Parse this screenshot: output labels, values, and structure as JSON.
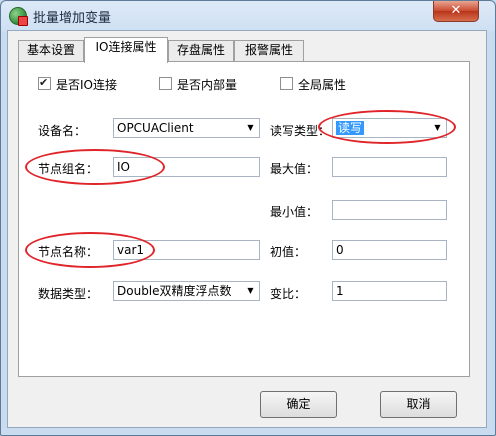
{
  "window": {
    "title": "批量增加变量",
    "close_glyph": "✕"
  },
  "tabs": [
    {
      "label": "基本设置"
    },
    {
      "label": "IO连接属性"
    },
    {
      "label": "存盘属性"
    },
    {
      "label": "报警属性"
    }
  ],
  "checkboxes": {
    "io_connect": {
      "label": "是否IO连接",
      "checked": true
    },
    "internal": {
      "label": "是否内部量",
      "checked": false
    },
    "global": {
      "label": "全局属性",
      "checked": false
    }
  },
  "fields": {
    "device_name": {
      "label": "设备名：",
      "value": "OPCUAClient"
    },
    "rw_type": {
      "label": "读写类型：",
      "value": "读写"
    },
    "node_group": {
      "label": "节点组名：",
      "value": "IO"
    },
    "max_value": {
      "label": "最大值：",
      "value": ""
    },
    "min_value": {
      "label": "最小值：",
      "value": ""
    },
    "node_name": {
      "label": "节点名称：",
      "value": "var1"
    },
    "init_value": {
      "label": "初值：",
      "value": "0"
    },
    "data_type": {
      "label": "数据类型：",
      "value": "Double双精度浮点数"
    },
    "ratio": {
      "label": "变比：",
      "value": "1"
    }
  },
  "buttons": {
    "ok": "确定",
    "cancel": "取消"
  },
  "colors": {
    "annotation": "#e0252a",
    "selection": "#3399ff"
  }
}
